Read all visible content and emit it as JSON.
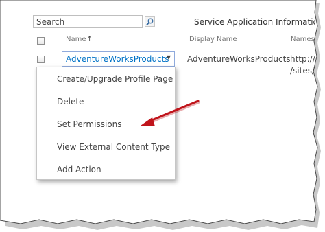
{
  "search": {
    "value": "Search"
  },
  "header": {
    "title": "Service Application Information"
  },
  "columns": {
    "name": "Name",
    "sort_indicator": "↑",
    "display_name": "Display Name",
    "namespace": "Namesp"
  },
  "row": {
    "name": "AdventureWorksProducts",
    "display_name": "AdventureWorksProducts",
    "namespace_line1": "http://i",
    "namespace_line2": "/sites/c"
  },
  "context_menu": {
    "items": [
      {
        "label": "Create/Upgrade Profile Page"
      },
      {
        "label": "Delete"
      },
      {
        "label": "Set Permissions"
      },
      {
        "label": "View External Content Type"
      },
      {
        "label": "Add Action"
      }
    ]
  },
  "annotation": {
    "arrow_color": "#c0141b"
  }
}
